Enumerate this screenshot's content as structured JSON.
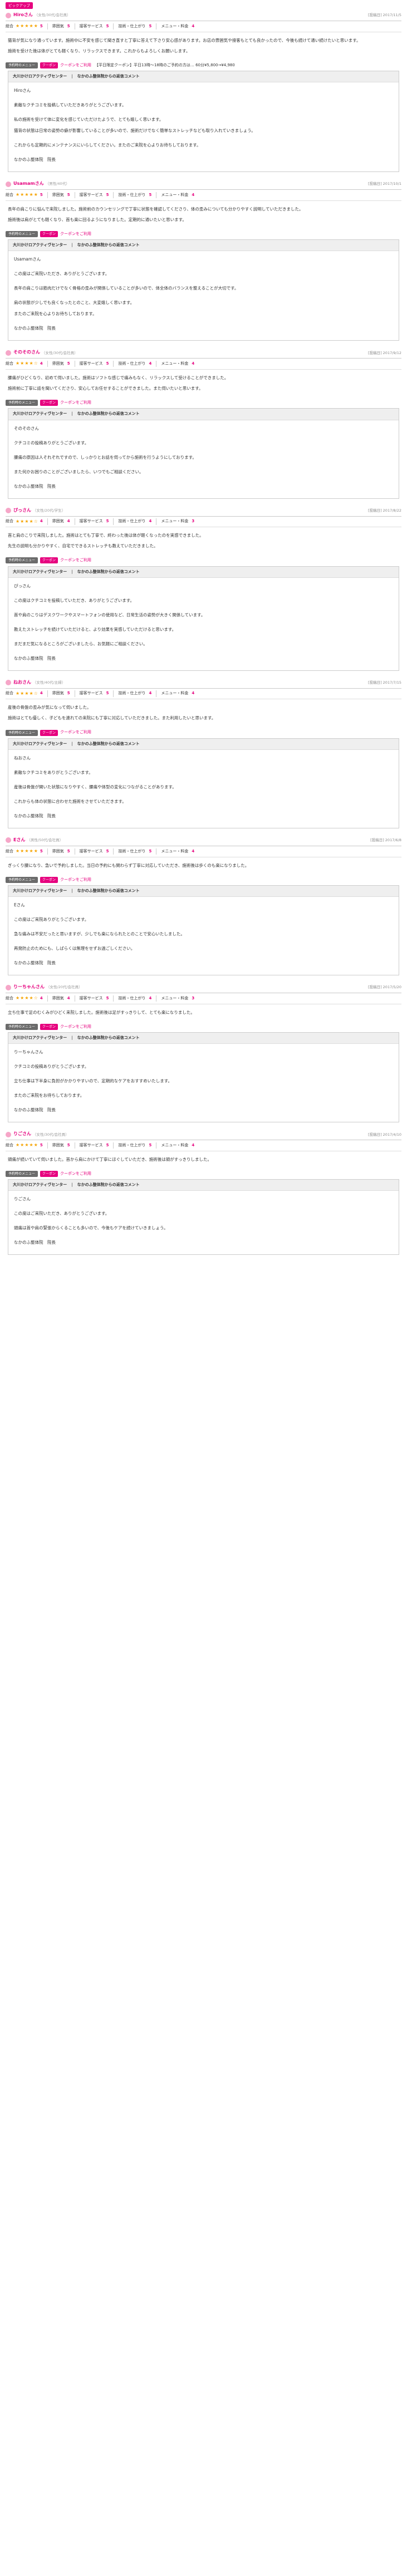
{
  "labels": {
    "overall": "総合",
    "cat1": "雰囲気",
    "cat2": "接客サービス",
    "cat3": "技術・仕上がり",
    "cat4": "メニュー・料金",
    "menu_button": "予約時のメニュー",
    "coupon_badge": "クーポン",
    "reply_from": "大川かけロアクティヴセンター",
    "reply_title": "なかのふ整体院からの返信コメント",
    "reply_sep": "|"
  },
  "reviews": [
    {
      "pickup": "ピックアップ",
      "name": "Hiroさん",
      "meta": "（女性/30代/会社員）",
      "visit": "[投稿日] 2017/11/5",
      "overall": "5",
      "stars": "★★★★★",
      "c1": "5",
      "c2": "5",
      "c3": "5",
      "c4": "4",
      "menu": "クーポンをご利用",
      "menu_sub": "【平日限定クーポン】平日13時〜18時のご予約の方は… 60分¥5,800→¥4,980",
      "body": [
        "猫背が気になり通っています。施術中に不安を感じて聞き直すと丁寧に答えて下さり安心感があります。お店の雰囲気や接客もとても良かったので、今後も続けて通い続けたいと思います。",
        "施術を受けた後は体がとても軽くなり、リラックスできます。これからもよろしくお願いします。"
      ],
      "reply": [
        "Hiroさん",
        "",
        "素敵なクチコミを投稿していただきありがとうございます。",
        "",
        "私の施術を受けて体に変化を感じていただけたようで、とても嬉しく思います。",
        "猫背の状態は日常の姿勢の癖が影響していることが多いので、施術だけでなく簡単なストレッチなども取り入れていきましょう。",
        "",
        "これからも定期的にメンテナンスにいらしてください。またのご来院を心よりお待ちしております。",
        "",
        "なかのふ整体院　院長"
      ]
    },
    {
      "pickup": "",
      "name": "Usamamさん",
      "meta": "（男性/40代）",
      "visit": "[投稿日] 2017/10/1",
      "overall": "5",
      "stars": "★★★★★",
      "c1": "5",
      "c2": "5",
      "c3": "5",
      "c4": "4",
      "menu": "クーポンをご利用",
      "menu_sub": "",
      "body": [
        "長年の肩こりに悩んで来院しました。施術前のカウンセリングで丁寧に状態を確認してくださり、体の歪みについても分かりやすく説明していただきました。",
        "施術後は肩がとても軽くなり、首も楽に回るようになりました。定期的に通いたいと思います。"
      ],
      "reply": [
        "Usamamさん",
        "",
        "この度はご来院いただき、ありがとうございます。",
        "",
        "長年の肩こりは筋肉だけでなく骨格の歪みが関係していることが多いので、体全体のバランスを整えることが大切です。",
        "",
        "肩の状態が少しでも良くなったとのこと、大変嬉しく思います。",
        "またのご来院を心よりお待ちしております。",
        "",
        "なかのふ整体院　院長"
      ]
    },
    {
      "pickup": "",
      "name": "そのそのさん",
      "meta": "（女性/30代/会社員）",
      "visit": "[投稿日] 2017/9/12",
      "overall": "4",
      "stars": "★★★★☆",
      "c1": "5",
      "c2": "5",
      "c3": "4",
      "c4": "4",
      "menu": "クーポンをご利用",
      "menu_sub": "",
      "body": [
        "腰痛がひどくなり、初めて伺いました。施術はソフトな感じで痛みもなく、リラックスして受けることができました。",
        "施術前に丁寧に話を聞いてくださり、安心してお任せすることができました。また伺いたいと思います。"
      ],
      "reply": [
        "そのそのさん",
        "",
        "クチコミの投稿ありがとうございます。",
        "",
        "腰痛の原因は人それぞれですので、しっかりとお話を伺ってから施術を行うようにしております。",
        "",
        "また何かお困りのことがございましたら、いつでもご相談ください。",
        "",
        "なかのふ整体院　院長"
      ]
    },
    {
      "pickup": "",
      "name": "ぴっさん",
      "meta": "（女性/20代/学生）",
      "visit": "[投稿日] 2017/8/22",
      "overall": "4",
      "stars": "★★★★☆",
      "c1": "4",
      "c2": "5",
      "c3": "4",
      "c4": "3",
      "menu": "クーポンをご利用",
      "menu_sub": "",
      "body": [
        "首と肩のこりで来院しました。施術はとても丁寧で、終わった後は体が軽くなったのを実感できました。",
        "先生の説明も分かりやすく、自宅でできるストレッチも教えていただきました。"
      ],
      "reply": [
        "ぴっさん",
        "",
        "この度はクチコミを投稿していただき、ありがとうございます。",
        "",
        "首や肩のこりはデスクワークやスマートフォンの使用など、日常生活の姿勢が大きく関係しています。",
        "",
        "教えたストレッチを続けていただけると、より効果を実感していただけると思います。",
        "",
        "まだまだ気になるところがございましたら、お気軽にご相談ください。",
        "",
        "なかのふ整体院　院長"
      ]
    },
    {
      "pickup": "",
      "name": "ねおさん",
      "meta": "（女性/40代/主婦）",
      "visit": "[投稿日] 2017/7/15",
      "overall": "4",
      "stars": "★★★★☆",
      "c1": "5",
      "c2": "5",
      "c3": "4",
      "c4": "4",
      "menu": "クーポンをご利用",
      "menu_sub": "",
      "body": [
        "産後の骨盤の歪みが気になって伺いました。",
        "施術はとても優しく、子どもを連れての来院にも丁寧に対応していただきました。また利用したいと思います。"
      ],
      "reply": [
        "ねおさん",
        "",
        "素敵なクチコミをありがとうございます。",
        "",
        "産後は骨盤が開いた状態になりやすく、腰痛や体型の変化につながることがあります。",
        "",
        "これからも体の状態に合わせた施術をさせていただきます。",
        "",
        "なかのふ整体院　院長"
      ]
    },
    {
      "pickup": "",
      "name": "Eさん",
      "meta": "（男性/50代/会社員）",
      "visit": "[投稿日] 2017/6/8",
      "overall": "5",
      "stars": "★★★★★",
      "c1": "5",
      "c2": "5",
      "c3": "5",
      "c4": "4",
      "menu": "クーポンをご利用",
      "menu_sub": "",
      "body": [
        "ぎっくり腰になり、急いで予約しました。当日の予約にも関わらず丁寧に対応していただき、施術後は歩くのも楽になりました。"
      ],
      "reply": [
        "Eさん",
        "",
        "この度はご来院ありがとうございます。",
        "",
        "急な痛みは不安だったと思いますが、少しでも楽になられたとのことで安心いたしました。",
        "",
        "再発防止のためにも、しばらくは無理をせずお過ごしください。",
        "",
        "なかのふ整体院　院長"
      ]
    },
    {
      "pickup": "",
      "name": "りーちゃんさん",
      "meta": "（女性/20代/会社員）",
      "visit": "[投稿日] 2017/5/20",
      "overall": "4",
      "stars": "★★★★☆",
      "c1": "4",
      "c2": "5",
      "c3": "4",
      "c4": "3",
      "menu": "クーポンをご利用",
      "menu_sub": "",
      "body": [
        "立ち仕事で足のむくみがひどく来院しました。施術後は足がすっきりして、とても楽になりました。"
      ],
      "reply": [
        "りーちゃんさん",
        "",
        "クチコミの投稿ありがとうございます。",
        "",
        "立ち仕事は下半身に負担がかかりやすいので、定期的なケアをおすすめいたします。",
        "",
        "またのご来院をお待ちしております。",
        "",
        "なかのふ整体院　院長"
      ]
    },
    {
      "pickup": "",
      "name": "りごさん",
      "meta": "（女性/30代/会社員）",
      "visit": "[投稿日] 2017/4/10",
      "overall": "5",
      "stars": "★★★★★",
      "c1": "5",
      "c2": "5",
      "c3": "5",
      "c4": "4",
      "menu": "クーポンをご利用",
      "menu_sub": "",
      "body": [
        "頭痛が続いていて伺いました。首から肩にかけて丁寧にほぐしていただき、施術後は頭がすっきりしました。"
      ],
      "reply": [
        "りごさん",
        "",
        "この度はご来院いただき、ありがとうございます。",
        "",
        "頭痛は首や肩の緊張からくることも多いので、今後もケアを続けていきましょう。",
        "",
        "なかのふ整体院　院長"
      ]
    }
  ]
}
